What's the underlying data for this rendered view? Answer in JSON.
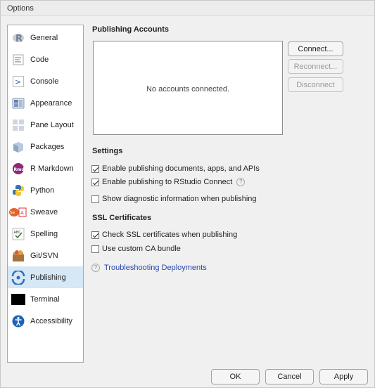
{
  "window": {
    "title": "Options"
  },
  "sidebar": {
    "items": [
      {
        "label": "General",
        "icon": "r-logo-icon"
      },
      {
        "label": "Code",
        "icon": "code-icon"
      },
      {
        "label": "Console",
        "icon": "console-icon"
      },
      {
        "label": "Appearance",
        "icon": "appearance-icon"
      },
      {
        "label": "Pane Layout",
        "icon": "pane-layout-icon"
      },
      {
        "label": "Packages",
        "icon": "packages-icon"
      },
      {
        "label": "R Markdown",
        "icon": "rmarkdown-icon"
      },
      {
        "label": "Python",
        "icon": "python-icon"
      },
      {
        "label": "Sweave",
        "icon": "sweave-icon"
      },
      {
        "label": "Spelling",
        "icon": "spelling-icon"
      },
      {
        "label": "Git/SVN",
        "icon": "git-icon"
      },
      {
        "label": "Publishing",
        "icon": "publishing-icon"
      },
      {
        "label": "Terminal",
        "icon": "terminal-icon"
      },
      {
        "label": "Accessibility",
        "icon": "accessibility-icon"
      }
    ],
    "selected": "Publishing"
  },
  "publishing": {
    "accounts_title": "Publishing Accounts",
    "empty_text": "No accounts connected.",
    "buttons": {
      "connect": "Connect...",
      "reconnect": "Reconnect...",
      "disconnect": "Disconnect"
    },
    "settings_title": "Settings",
    "settings": [
      {
        "label": "Enable publishing documents, apps, and APIs",
        "checked": true
      },
      {
        "label": "Enable publishing to RStudio Connect",
        "checked": true
      },
      {
        "label": "Show diagnostic information when publishing",
        "checked": false
      }
    ],
    "ssl_title": "SSL Certificates",
    "ssl": [
      {
        "label": "Check SSL certificates when publishing",
        "checked": true
      },
      {
        "label": "Use custom CA bundle",
        "checked": false
      }
    ],
    "help_link": "Troubleshooting Deployments",
    "help_glyph": "?"
  },
  "footer": {
    "ok": "OK",
    "cancel": "Cancel",
    "apply": "Apply"
  },
  "colors": {
    "selected_bg": "#d6e7f5",
    "link": "#2a47b0"
  }
}
